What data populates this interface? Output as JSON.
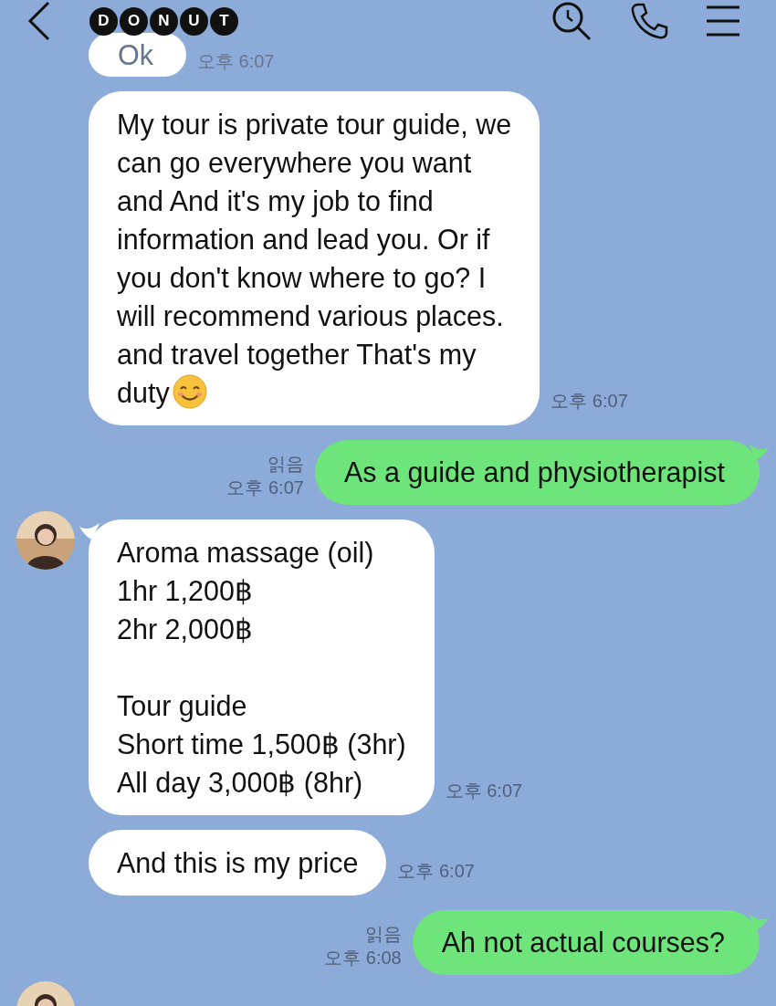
{
  "header": {
    "logo_letters": [
      "D",
      "O",
      "N",
      "U",
      "T"
    ]
  },
  "messages": [
    {
      "kind": "received",
      "text": "Ok",
      "time": "오후 6:07",
      "avatar": false,
      "smiley": false,
      "partial": true
    },
    {
      "kind": "received",
      "text": "My tour is private tour guide, we\ncan go everywhere you want\nand And it's my job to find\ninformation and lead you. Or if\nyou don't know where to go? I\nwill recommend various places.\nand travel together That's my\nduty",
      "time": "오후 6:07",
      "avatar": false,
      "smiley": true,
      "partial": false
    },
    {
      "kind": "sent",
      "text": "As a guide and physiotherapist",
      "time": "오후 6:07",
      "read": "읽음"
    },
    {
      "kind": "received",
      "text": "Aroma massage (oil)\n1hr 1,200฿\n2hr 2,000฿\n\nTour guide\nShort time 1,500฿ (3hr)\nAll day 3,000฿ (8hr)",
      "time": "오후 6:07",
      "avatar": true,
      "smiley": false,
      "partial": false
    },
    {
      "kind": "received",
      "text": "And this is my price",
      "time": "오후 6:07",
      "avatar": false,
      "smiley": false,
      "partial": false
    },
    {
      "kind": "sent",
      "text": "Ah not actual courses?",
      "time": "오후 6:08",
      "read": "읽음"
    },
    {
      "kind": "avatar_only",
      "avatar": true
    }
  ]
}
